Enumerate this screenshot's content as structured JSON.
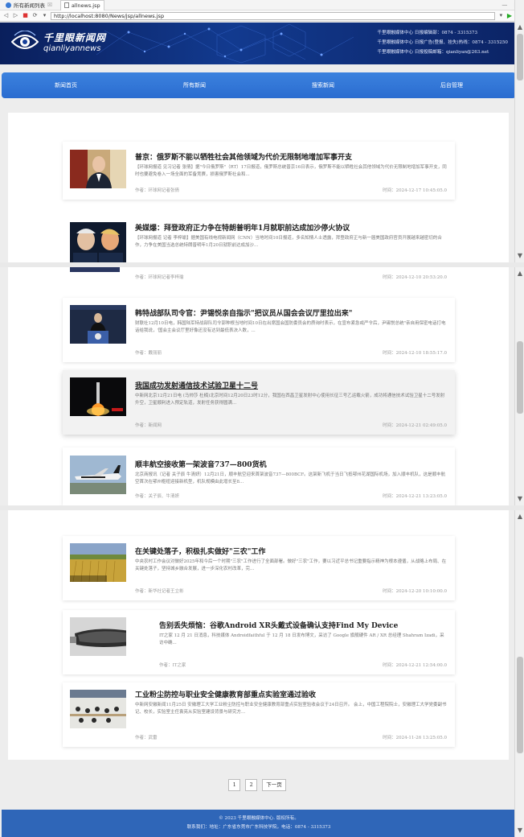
{
  "browser": {
    "tab1_title": "所有新闻列表",
    "tab2_title": "allnews.jsp",
    "url": "http://localhost:8080/News/jsp/allnews.jsp"
  },
  "header": {
    "logo_cn": "千里眼新闻网",
    "logo_en": "qianliyannews",
    "contact_line1": "千里眼融媒体中心 日报编辑部：0874 - 3315373",
    "contact_line2": "千里眼融媒体中心 日报广告(登报、挂失)热线：0874 - 3315250",
    "contact_line3": "千里眼融媒体中心 日报投稿邮箱：qianliyan@263.net"
  },
  "nav": {
    "home": "新闻首页",
    "all": "所有新闻",
    "search": "搜索新闻",
    "admin": "后台管理"
  },
  "articles": [
    {
      "title": "普京：俄罗斯不能以牺牲社会其他领域为代价无限制地增加军事开支",
      "summary": "【环球网报道 见习记者 张倩】据\"今日俄罗斯\"（RT）17日报道，俄罗斯总统普京16日表示，俄罗斯不能以牺牲社会其他领域为代价无限制地增加军事开支，同时也要避免卷入一场全面的军备竞赛，损害俄罗斯社会和...",
      "author": "作者：环球网记者张倩",
      "time": "时间：2024-12-17 10:45:05.0"
    },
    {
      "title": "美媒爆：拜登政府正力争在特朗普明年1月就职前达成加沙停火协议",
      "summary": "【环球网报道 记者 李梓瑜】据美国有线电视新闻网（CNN）当地时间10日报道，多名知情人士透露，拜登政府正与新一届美国政府官员开展越来越密切的合作，力争在美国当选总统特朗普明年1月20日就职前达成加沙...",
      "author": "作者：环球网记者李梓瑜",
      "time": "时间：2024-12-10 20:53:20.0"
    },
    {
      "title": "韩特战部队司令官：尹锡悦亲自指示\"把议员从国会会议厅里拉出来\"",
      "summary": "财联社12月10日电，韩国陆军特战部队司令郭种根当地时间10日在出席国会国防委员会的质询时表示，在宣布紧急戒严令后，尹锡悦总统\"亲自用保密电话打电话给我说，'国会主会议厅里好像还没有达到最低表决人数，...",
      "author": "作者：戴丽丽",
      "time": "时间：2024-12-10 18:55:17.0"
    },
    {
      "title": "我国成功发射通信技术试验卫星十二号",
      "summary": "中新网北京12月21日电 (马帅莎 杜楠)北京时间12月20日23时12分，我国在西昌卫星发射中心使用长征三号乙运载火箭，成功将通信技术试验卫星十二号发射升空，卫星顺利进入预定轨道，发射任务获得圆满...",
      "author": "作者：新闻网",
      "time": "时间：2024-12-21 02:49:05.0"
    },
    {
      "title": "顺丰航空接收第一架波音737—800货机",
      "summary": "北京商报讯（记者 关子辰 牛清妍）12月21日，顺丰航空迎来首架波音737—800BCF。这架新飞机于当日飞抵鄂州花湖国际机场，加入顺丰机队，这是顺丰航空首次在鄂州枢纽迎接新机型，机队规模由此增长至8...",
      "author": "作者：关子辰、牛清妍",
      "time": "时间：2024-12-21 13:23:05.0"
    },
    {
      "title": "在关键处落子，积极扎实做好\"三农\"工作",
      "summary": "中央农村工作会议对做好2025年和今后一个时期\"三农\"工作进行了全面部署。做好\"三农\"工作，要以习近平总书记重要指示精神为根本遵循，从战略上布局、在关键处落子，坚持城乡融合发展，进一步深化农村改革，完...",
      "author": "作者：新华社记者王立彬",
      "time": "时间：2024-12-20 10:10:00.0"
    },
    {
      "title": "告别丢失烦恼：谷歌Android XR头戴式设备确认支持Find My Device",
      "summary": "IT之家 12 月 21 日消息，科技媒体 Androidfaithful 于 12 月 18 日发布博文，采访了 Google 旗舰硬件 AR / XR 总经理 Shahram Izadi，采访中确...",
      "author": "作者：IT之家",
      "time": "时间：2024-12-21 12:54:00.0"
    },
    {
      "title": "工业粉尘防控与职业安全健康教育部重点实验室通过验收",
      "summary": "中新网安徽新闻11月25日 安徽理工大学工业粉尘防控与职业安全健康教育部重点实验室验收会议于24日召开。 会上，中国工程院院士，安徽理工大学党委副书记、校长，实验室主任袁亮从实验室建设背景与研究方...",
      "author": "作者：武雷",
      "time": "时间：2024-11-26 13:25:05.0"
    }
  ],
  "pagination": {
    "page1": "1",
    "page2": "2",
    "next": "下一页"
  },
  "footer": {
    "copyright": "© 2023 千里眼融媒体中心. 版权所有。",
    "contact": "联系我们：地址：广东省东莞市广东科技学院，电话：0874 - 3315373"
  }
}
